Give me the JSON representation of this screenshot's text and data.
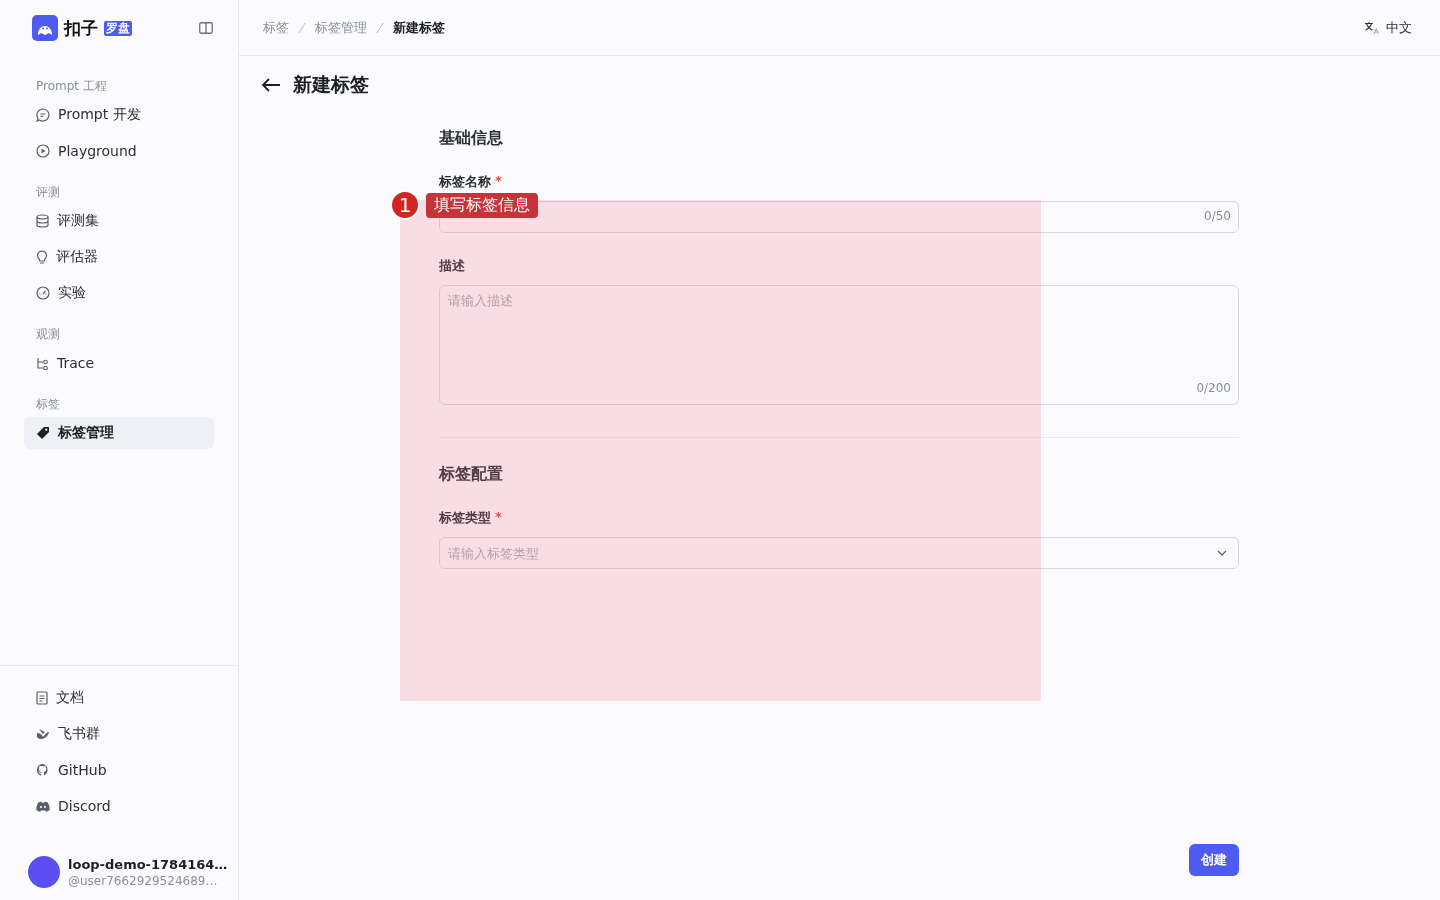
{
  "sidebar": {
    "logo": {
      "name": "扣子",
      "badge": "罗盘"
    },
    "sections": [
      {
        "title": "Prompt 工程",
        "items": [
          {
            "label": "Prompt 开发",
            "selected": false
          },
          {
            "label": "Playground",
            "selected": false
          }
        ]
      },
      {
        "title": "评测",
        "items": [
          {
            "label": "评测集",
            "selected": false
          },
          {
            "label": "评估器",
            "selected": false
          },
          {
            "label": "实验",
            "selected": false
          }
        ]
      },
      {
        "title": "观测",
        "items": [
          {
            "label": "Trace",
            "selected": false
          }
        ]
      },
      {
        "title": "标签",
        "items": [
          {
            "label": "标签管理",
            "selected": true
          }
        ]
      }
    ],
    "footer_links": [
      "文档",
      "飞书群",
      "GitHub",
      "Discord"
    ],
    "user": {
      "name": "loop-demo-1784164…",
      "handle": "@user7662929524689…"
    }
  },
  "breadcrumb": [
    {
      "label": "标签",
      "current": false
    },
    {
      "label": "标签管理",
      "current": false
    },
    {
      "label": "新建标签",
      "current": true
    }
  ],
  "language": "中文",
  "page_title": "新建标签",
  "sections": [
    {
      "title": "基础信息",
      "fields": [
        {
          "kind": "input",
          "label": "标签名称",
          "required_mark": "*",
          "counter": "0/50"
        },
        {
          "kind": "textarea",
          "label": "描述",
          "placeholder": "请输入描述",
          "counter": "0/200"
        }
      ]
    },
    {
      "title": "标签配置",
      "fields": [
        {
          "kind": "select",
          "label": "标签类型",
          "required_mark": "*",
          "placeholder": "请输入标签类型"
        }
      ]
    }
  ],
  "submit": "创建",
  "annotation": {
    "number": "1",
    "label": "填写标签信息"
  }
}
